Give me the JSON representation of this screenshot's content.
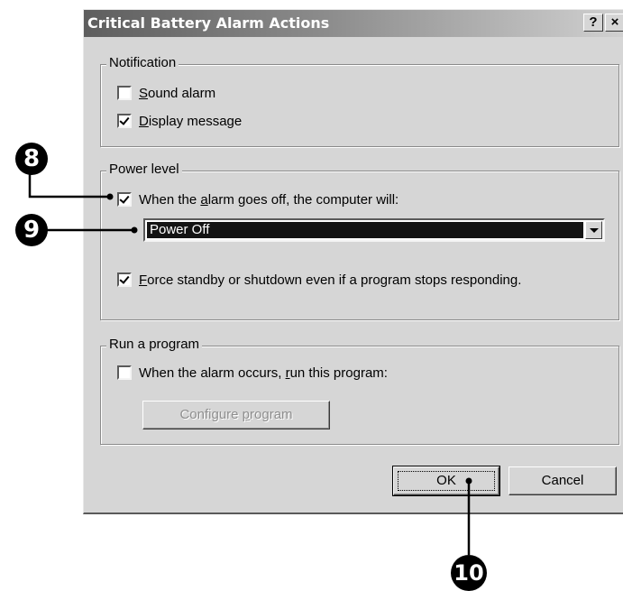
{
  "dialog": {
    "title": "Critical Battery Alarm Actions",
    "help_label": "?",
    "close_label": "×"
  },
  "notification": {
    "legend": "Notification",
    "sound_alarm": {
      "pre": "",
      "u": "S",
      "post": "ound alarm",
      "checked": false
    },
    "display_message": {
      "pre": "",
      "u": "D",
      "post": "isplay message",
      "checked": true
    }
  },
  "power_level": {
    "legend": "Power level",
    "alarm_action": {
      "pre": "When the ",
      "u": "a",
      "post": "larm goes off, the computer will:",
      "checked": true
    },
    "action_select_value": "Power Off",
    "force": {
      "pre": "",
      "u": "F",
      "post": "orce standby or shutdown even if a program stops responding.",
      "checked": true
    }
  },
  "run_program": {
    "legend": "Run a program",
    "run_on_alarm": {
      "pre": "When the alarm occurs, ",
      "u": "r",
      "post": "un this program:",
      "checked": false
    },
    "configure": {
      "pre": "Configure ",
      "u": "p",
      "post": "rogram",
      "enabled": false
    }
  },
  "buttons": {
    "ok": "OK",
    "cancel": "Cancel"
  },
  "callouts": {
    "c8": "8",
    "c9": "9",
    "c10": "10"
  }
}
